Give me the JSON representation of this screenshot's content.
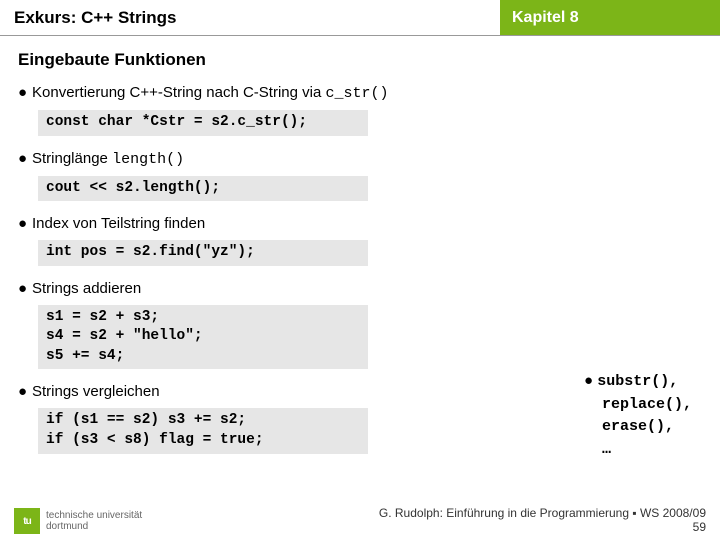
{
  "header": {
    "left": "Exkurs: C++ Strings",
    "right": "Kapitel 8"
  },
  "section_title": "Eingebaute Funktionen",
  "bullets": {
    "b1_pre": "Konvertierung C++-String nach C-String via ",
    "b1_code": "c_str()",
    "b1_box": "const char *Cstr = s2.c_str();",
    "b2_pre": "Stringlänge ",
    "b2_code": "length()",
    "b2_box": "cout << s2.length();",
    "b3": "Index von Teilstring finden",
    "b3_box": "int pos = s2.find(\"yz\");",
    "b4": "Strings addieren",
    "b4_box": "s1 = s2 + s3;\ns4 = s2 + \"hello\";\ns5 += s4;",
    "b5": "Strings vergleichen",
    "b5_box": "if (s1 == s2) s3 += s2;\nif (s3 < s8) flag = true;"
  },
  "side": {
    "l1": "substr(),",
    "l2": "replace(),",
    "l3": "erase(),",
    "l4": "…"
  },
  "footer": {
    "uni1": "technische universität",
    "uni2": "dortmund",
    "tu": "tu",
    "credit": "G. Rudolph: Einführung in die Programmierung ▪ WS 2008/09",
    "page": "59"
  }
}
